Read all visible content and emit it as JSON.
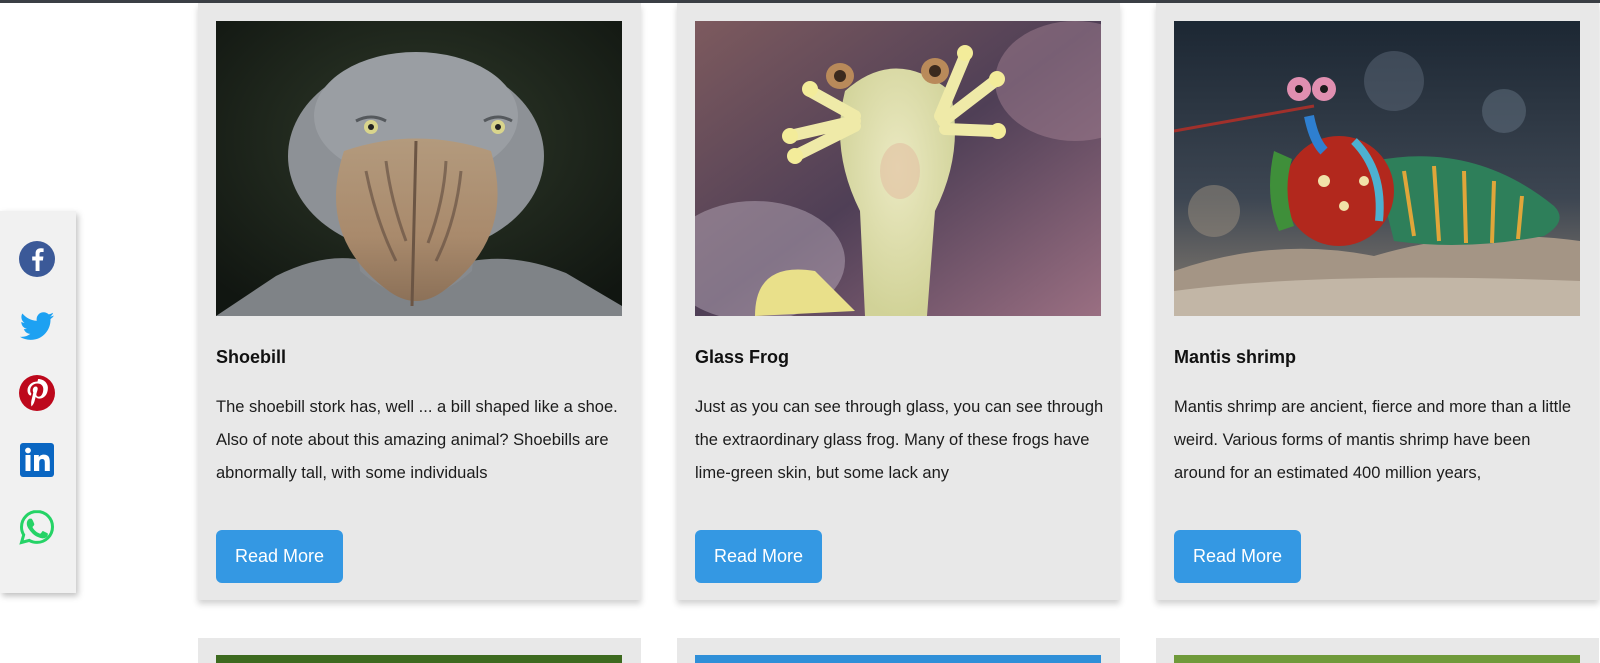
{
  "share": {
    "icons": [
      "facebook-icon",
      "twitter-icon",
      "pinterest-icon",
      "linkedin-icon",
      "whatsapp-icon"
    ],
    "colors": {
      "facebook": "#3b5998",
      "twitter": "#1da1f2",
      "pinterest": "#bd081c",
      "linkedin": "#0a66c2",
      "whatsapp": "#25d366"
    }
  },
  "cards": [
    {
      "title": "Shoebill",
      "description": "The shoebill stork has, well ... a bill shaped like a shoe. Also of note about this amazing animal? Shoebills are abnormally tall, with some individuals",
      "button": "Read More"
    },
    {
      "title": "Glass Frog",
      "description": "Just as you can see through glass, you can see through the extraordinary glass frog. Many of these frogs have lime-green skin, but some lack any",
      "button": "Read More"
    },
    {
      "title": "Mantis shrimp",
      "description": "Mantis shrimp are ancient, fierce and more than a little weird. Various forms of mantis shrimp have been around for an estimated 400 million years,",
      "button": "Read More"
    }
  ],
  "accent_color": "#3498e3"
}
